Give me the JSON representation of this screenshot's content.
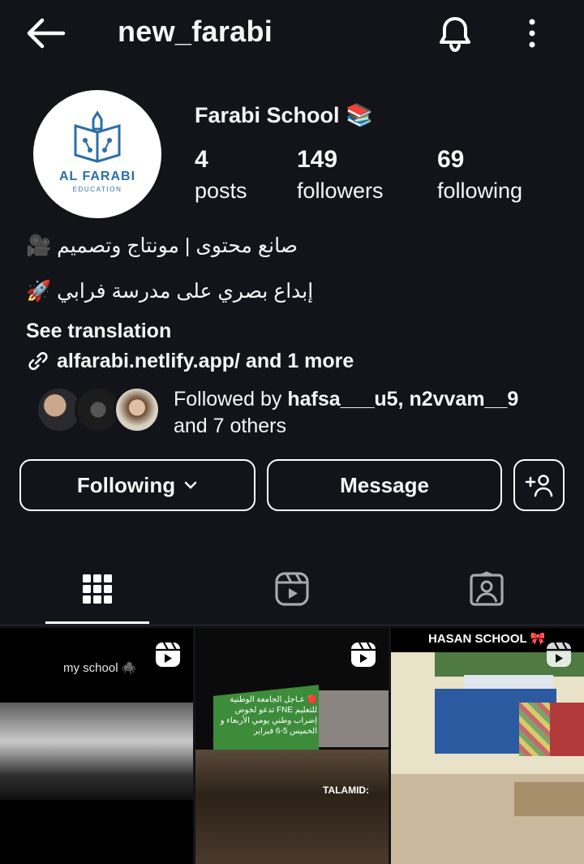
{
  "header": {
    "username": "new_farabi",
    "back_icon": "arrow-left-icon",
    "bell_icon": "bell-icon",
    "more_icon": "kebab-menu-icon"
  },
  "profile": {
    "avatar_logo_name": "AL FARABI",
    "avatar_logo_sub": "EDUCATION",
    "display_name": "Farabi School 📚",
    "stats": [
      {
        "num": "4",
        "label": "posts"
      },
      {
        "num": "149",
        "label": "followers"
      },
      {
        "num": "69",
        "label": "following"
      }
    ],
    "bio_line_1": "صانع محتوى | مونتاج وتصميم 🎥",
    "bio_line_2": "إبداع بصري على مدرسة فرابي 🚀",
    "see_translation": "See translation",
    "link": "alfarabi.netlify.app/ and 1 more",
    "followed_by_prefix": "Followed by ",
    "followed_by_names": "hafsa___u5, n2vvam__9",
    "followed_by_suffix": "and 7 others"
  },
  "actions": {
    "following_label": "Following",
    "message_label": "Message"
  },
  "tabs": [
    {
      "name": "grid-icon",
      "active": true
    },
    {
      "name": "reels-icon",
      "active": false
    },
    {
      "name": "tagged-icon",
      "active": false
    }
  ],
  "posts": [
    {
      "label": "my school 🕷️"
    },
    {
      "headline": "🔴 عـاجل\nالجامعة الوطنية للتعليم FNE تدعو لخوض إضراب وطني يومي الأربعاء و الخميس 5-6 فبراير",
      "caption": "TALAMID:"
    },
    {
      "title": "HASAN SCHOOL 🎀"
    }
  ],
  "colors": {
    "background": "#12141a",
    "text": "#f5f5f5",
    "logo_blue": "#2b6fa8"
  }
}
